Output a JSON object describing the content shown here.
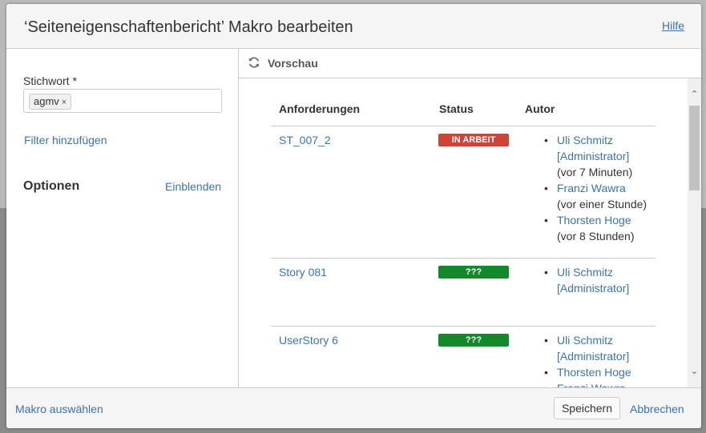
{
  "dialog": {
    "title": "‘Seiteneigenschaftenbericht’ Makro bearbeiten",
    "help_label": "Hilfe"
  },
  "left": {
    "field_label": "Stichwort *",
    "tag": "agmv",
    "tag_remove": "×",
    "filter_link": "Filter hinzufügen",
    "options_heading": "Optionen",
    "show_link": "Einblenden"
  },
  "preview": {
    "label": "Vorschau",
    "icon": "refresh-icon",
    "columns": [
      "Anforderungen",
      "Status",
      "Autor"
    ],
    "rows": [
      {
        "requirement": "ST_007_2",
        "status": "IN ARBEIT",
        "status_color": "#d04437",
        "authors": [
          {
            "name": "Uli Schmitz [Administrator]",
            "time": "(vor 7 Minuten)"
          },
          {
            "name": "Franzi Wawra",
            "time": "(vor einer Stunde)"
          },
          {
            "name": "Thorsten Hoge",
            "time": "(vor 8 Stunden)"
          }
        ]
      },
      {
        "requirement": "Story 081",
        "status": "???",
        "status_color": "#14892c",
        "authors": [
          {
            "name": "Uli Schmitz [Administrator]",
            "time": ""
          }
        ]
      },
      {
        "requirement": "UserStory 6",
        "status": "???",
        "status_color": "#14892c",
        "authors": [
          {
            "name": "Uli Schmitz [Administrator]",
            "time": ""
          },
          {
            "name": "Thorsten Hoge",
            "time": ""
          },
          {
            "name": "Franzi Wawra",
            "time": ""
          }
        ]
      }
    ]
  },
  "footer": {
    "select_macro": "Makro auswählen",
    "save_label": "Speichern",
    "cancel_label": "Abbrechen"
  }
}
